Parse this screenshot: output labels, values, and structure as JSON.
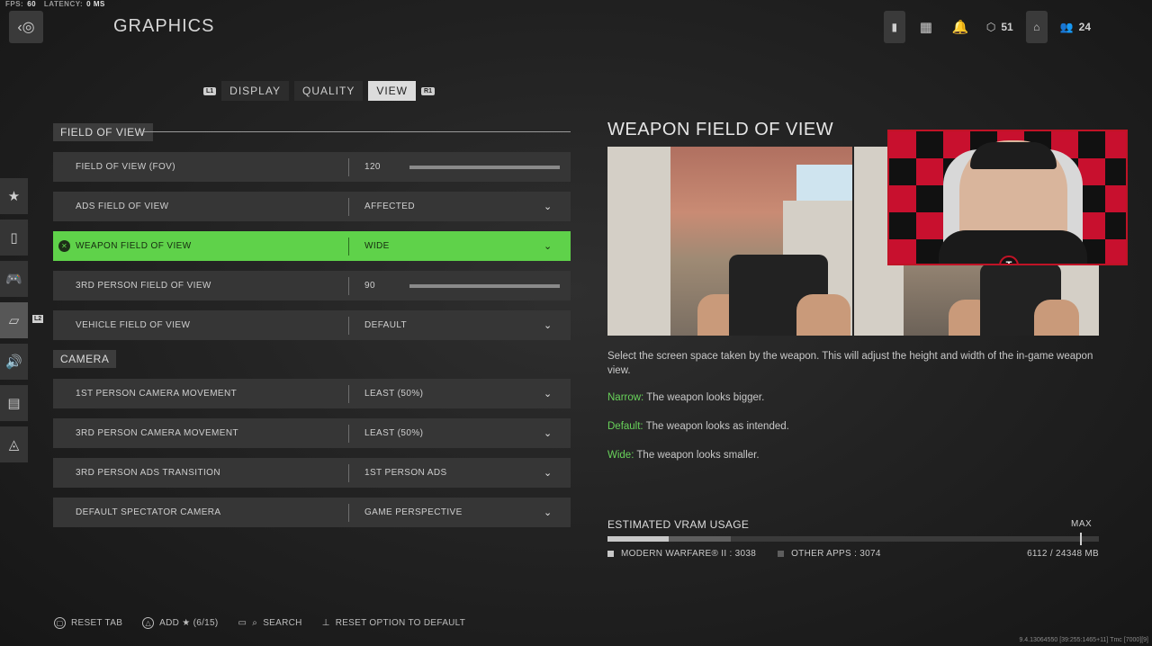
{
  "hud": {
    "fps_label": "FPS:",
    "fps_value": "60",
    "latency_label": "LATENCY:",
    "latency_value": "0 MS"
  },
  "header": {
    "title": "GRAPHICS",
    "rank": "51",
    "party_count": "24"
  },
  "tabs": {
    "left_bumper": "L1",
    "right_bumper": "R1",
    "items": [
      {
        "label": "DISPLAY"
      },
      {
        "label": "QUALITY"
      },
      {
        "label": "VIEW"
      }
    ]
  },
  "sidebar": {
    "badge": "L2"
  },
  "sections": {
    "fov": "FIELD OF VIEW",
    "camera": "CAMERA"
  },
  "rows": [
    {
      "label": "FIELD OF VIEW (FOV)",
      "value": "120",
      "type": "slider",
      "fill": 1.0
    },
    {
      "label": "ADS FIELD OF VIEW",
      "value": "AFFECTED",
      "type": "dropdown"
    },
    {
      "label": "WEAPON FIELD OF VIEW",
      "value": "WIDE",
      "type": "dropdown"
    },
    {
      "label": "3RD PERSON FIELD OF VIEW",
      "value": "90",
      "type": "slider",
      "fill": 1.0
    },
    {
      "label": "VEHICLE FIELD OF VIEW",
      "value": "DEFAULT",
      "type": "dropdown"
    },
    {
      "label": "1ST PERSON CAMERA MOVEMENT",
      "value": "LEAST (50%)",
      "type": "dropdown"
    },
    {
      "label": "3RD PERSON CAMERA MOVEMENT",
      "value": "LEAST (50%)",
      "type": "dropdown"
    },
    {
      "label": "3RD PERSON ADS TRANSITION",
      "value": "1ST PERSON ADS",
      "type": "dropdown"
    },
    {
      "label": "DEFAULT SPECTATOR CAMERA",
      "value": "GAME PERSPECTIVE",
      "type": "dropdown"
    }
  ],
  "detail": {
    "title": "WEAPON FIELD OF VIEW",
    "description": "Select the screen space taken by the weapon. This will adjust the height and width of the in-game weapon view.",
    "options": [
      {
        "key": "Narrow:",
        "text": " The weapon looks bigger."
      },
      {
        "key": "Default:",
        "text": " The weapon looks as intended."
      },
      {
        "key": "Wide:",
        "text": " The weapon looks smaller."
      }
    ]
  },
  "vram": {
    "title": "ESTIMATED VRAM USAGE",
    "max_label": "MAX",
    "mw_label": "MODERN WARFARE® II : 3038",
    "other_label": "OTHER APPS : 3074",
    "total": "6112 / 24348 MB",
    "mw_mb": 3038,
    "other_mb": 3074,
    "total_mb": 24348,
    "colors": {
      "mw": "#c8c8c8",
      "other": "#5e5e5e"
    }
  },
  "footer": {
    "reset_tab": "RESET TAB",
    "add": "ADD ★ (6/15)",
    "search": "SEARCH",
    "reset_option": "RESET OPTION TO DEFAULT"
  },
  "build": "9.4.13064550 [39:255:1465+11] Tmc [7000][9]",
  "colors": {
    "accent": "#5fd24a",
    "key_text": "#68d25a",
    "stream_border": "#c01326"
  }
}
